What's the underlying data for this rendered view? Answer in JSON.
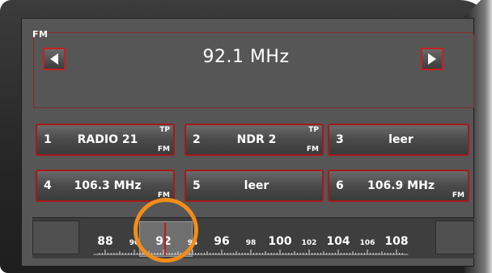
{
  "tuner": {
    "band": "FM",
    "frequency": "92.1 MHz"
  },
  "presets": [
    {
      "number": "1",
      "name": "RADIO 21",
      "tp": "TP",
      "fm": "FM"
    },
    {
      "number": "2",
      "name": "NDR 2",
      "tp": "TP",
      "fm": "FM"
    },
    {
      "number": "3",
      "name": "leer",
      "tp": "",
      "fm": ""
    },
    {
      "number": "4",
      "name": "106.3 MHz",
      "tp": "",
      "fm": "FM"
    },
    {
      "number": "5",
      "name": "leer",
      "tp": "",
      "fm": ""
    },
    {
      "number": "6",
      "name": "106.9 MHz",
      "tp": "",
      "fm": "FM"
    }
  ],
  "scale": {
    "major_labels": [
      "88",
      "92",
      "96",
      "100",
      "104",
      "108"
    ],
    "minor_labels": [
      "90",
      "94",
      "98",
      "102",
      "106"
    ],
    "current_value_mhz": 92.1,
    "range_mhz": [
      87.5,
      108
    ]
  },
  "colors": {
    "accent_border": "#c52020",
    "highlight_circle": "#f28c1a",
    "cursor_line": "#c41818"
  }
}
